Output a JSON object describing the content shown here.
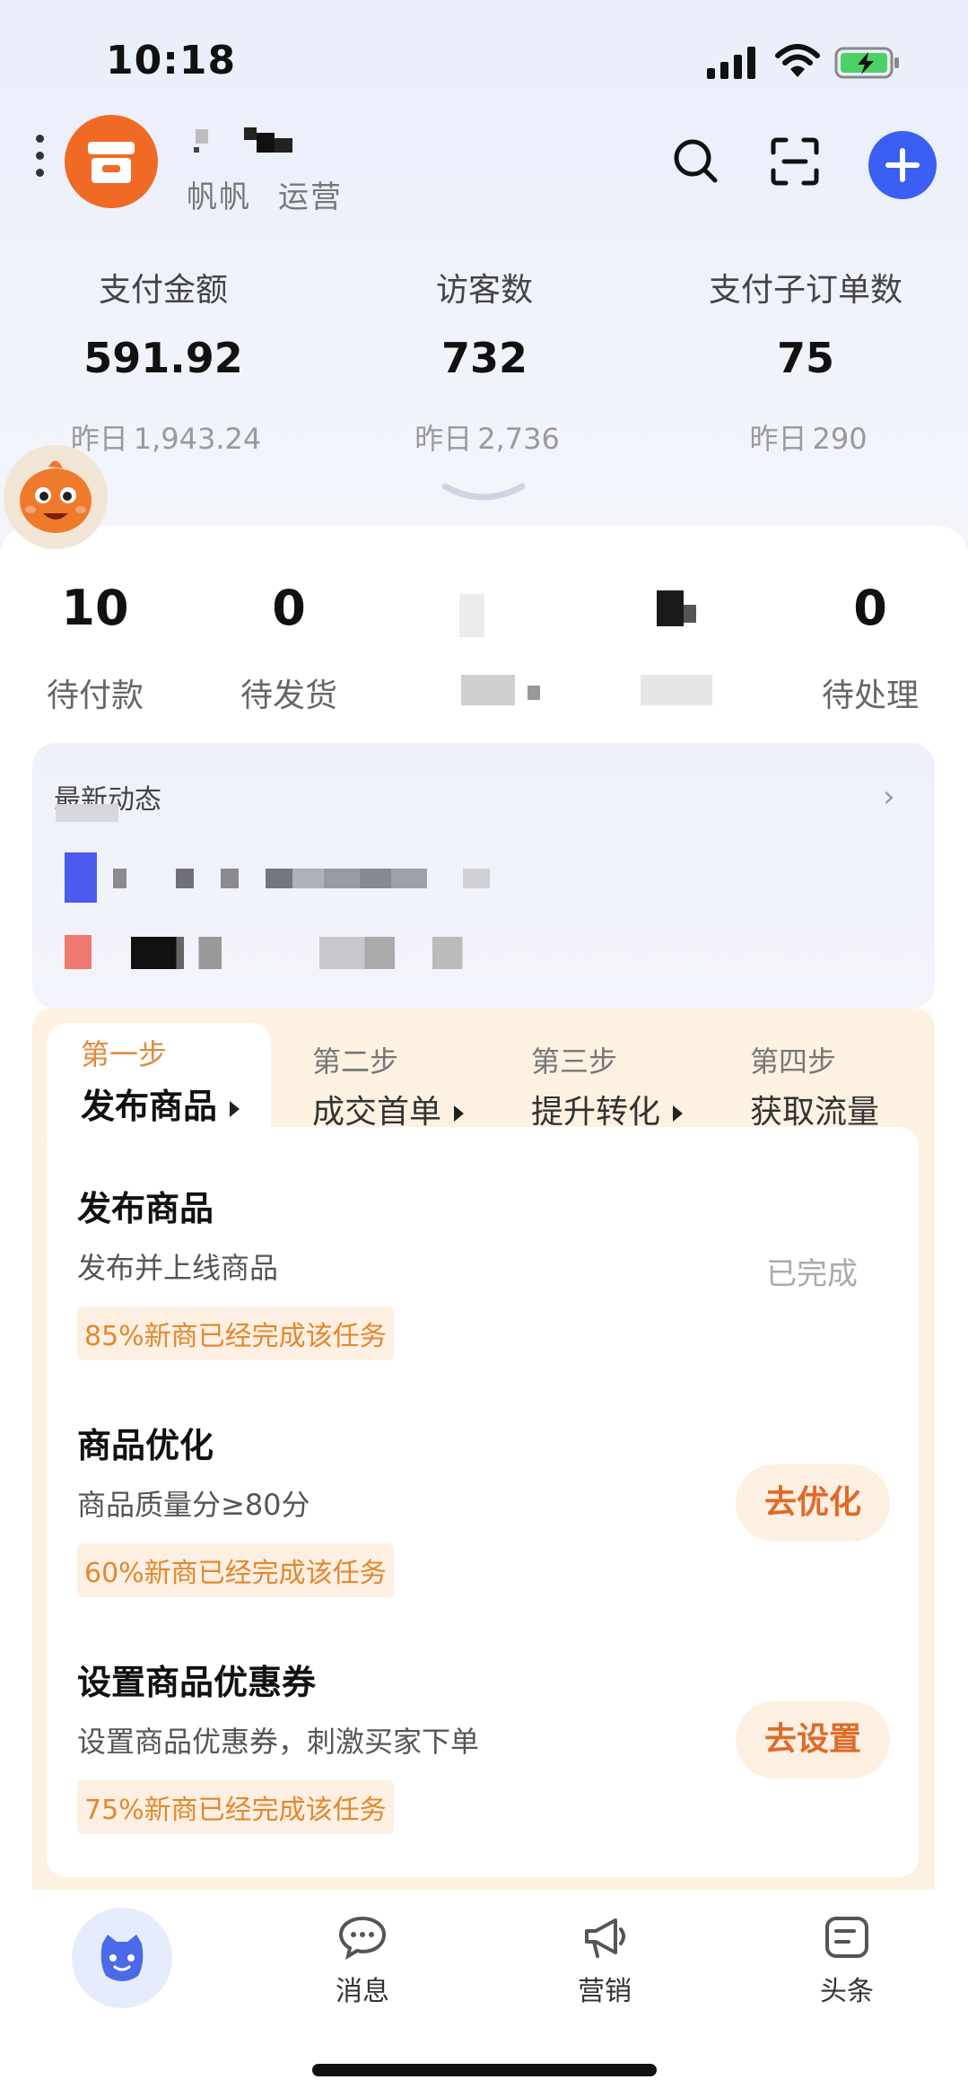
{
  "status_bar": {
    "time": "10:18"
  },
  "header": {
    "shop_name_redacted": true,
    "shop_role": [
      "帆帆",
      "运营"
    ]
  },
  "stats": [
    {
      "label": "支付金额",
      "value": "591.92",
      "yesterday_prefix": "昨日",
      "yesterday": "1,943.24"
    },
    {
      "label": "访客数",
      "value": "732",
      "yesterday_prefix": "昨日",
      "yesterday": "2,736"
    },
    {
      "label": "支付子订单数",
      "value": "75",
      "yesterday_prefix": "昨日",
      "yesterday": "290"
    }
  ],
  "orders": [
    {
      "count": "10",
      "label": "待付款"
    },
    {
      "count": "0",
      "label": "待发货"
    },
    {
      "count": "0",
      "label": "待处理"
    }
  ],
  "news": {
    "title": "最新动态"
  },
  "steps": [
    {
      "step": "第一步",
      "name": "发布商品"
    },
    {
      "step": "第二步",
      "name": "成交首单"
    },
    {
      "step": "第三步",
      "name": "提升转化"
    },
    {
      "step": "第四步",
      "name": "获取流量"
    }
  ],
  "tasks": [
    {
      "title": "发布商品",
      "desc": "发布并上线商品",
      "badge": "85%新商已经完成该任务",
      "status": "已完成"
    },
    {
      "title": "商品优化",
      "desc": "商品质量分≥80分",
      "badge": "60%新商已经完成该任务",
      "action": "去优化"
    },
    {
      "title": "设置商品优惠券",
      "desc": "设置商品优惠券，刺激买家下单",
      "badge": "75%新商已经完成该任务",
      "action": "去设置"
    }
  ],
  "tabbar": [
    {
      "label": "消息",
      "icon": "chat-icon"
    },
    {
      "label": "营销",
      "icon": "megaphone-icon"
    },
    {
      "label": "头条",
      "icon": "news-icon"
    }
  ],
  "colors": {
    "accent": "#3a5ff2",
    "logo": "#f06a25",
    "badge": "#e3872f",
    "action": "#e06a28"
  }
}
